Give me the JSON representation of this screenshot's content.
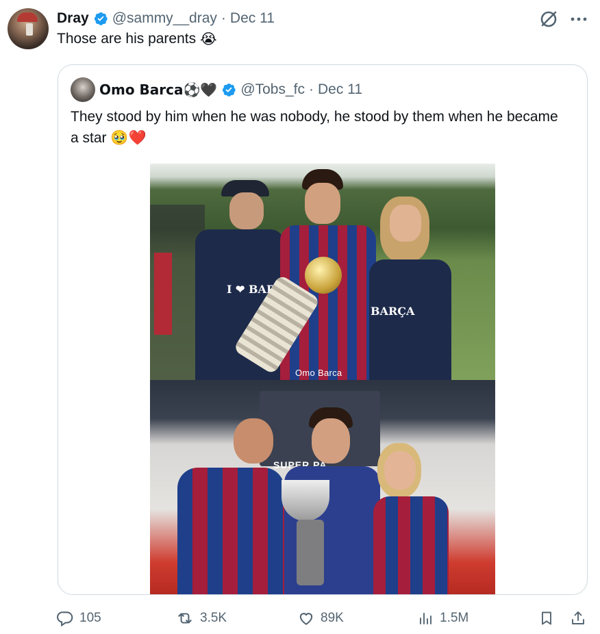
{
  "tweet": {
    "author_name": "Dray",
    "handle": "@sammy__dray",
    "separator": "·",
    "date": "Dec 11",
    "text": "Those are his parents",
    "emoji": "😭"
  },
  "quoted": {
    "author_name": "Omo Barca⚽️🖤",
    "handle": "@Tobs_fc",
    "separator": "·",
    "date": "Dec 11",
    "text": "They stood by him when he was nobody, he stood by them when he became a star 🥹❤️",
    "media": {
      "watermark": "Omo Barca",
      "shirt_text_left": "I ❤ BARÇA",
      "shirt_text_right": "BARÇA",
      "banner_text": "SUPER    PA"
    }
  },
  "actions": {
    "replies": "105",
    "reposts": "3.5K",
    "likes": "89K",
    "views": "1.5M"
  },
  "colors": {
    "verified": "#1d9bf0",
    "muted": "#536471",
    "border": "#cfd9de"
  },
  "icons": [
    "verified-badge-icon",
    "grok-icon",
    "more-icon",
    "reply-icon",
    "repost-icon",
    "like-icon",
    "views-icon",
    "bookmark-icon",
    "share-icon"
  ]
}
